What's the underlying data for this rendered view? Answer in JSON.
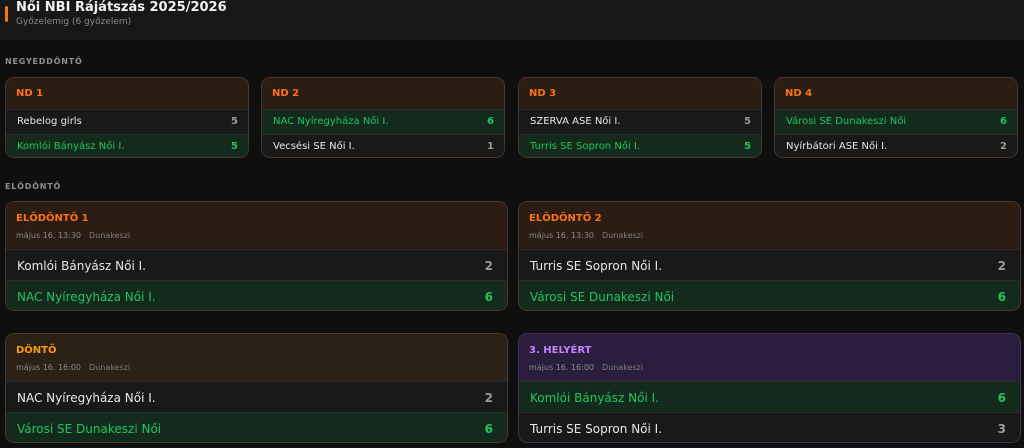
{
  "header": {
    "title": "Női NBI Rájátszás 2025/2026",
    "subtitle": "Győzelemig (6 győzelem)"
  },
  "sections": {
    "quarterfinals": "NEGYEDDÖNTŐ",
    "semifinals": "ELŐDÖNTŐ"
  },
  "quarterfinals": [
    {
      "label": "ND 1",
      "teams": [
        {
          "name": "Rebelog girls",
          "score": "5",
          "winner": false
        },
        {
          "name": "Komlói Bányász Női I.",
          "score": "5",
          "winner": true
        }
      ]
    },
    {
      "label": "ND 2",
      "teams": [
        {
          "name": "NAC Nyíregyháza Női I.",
          "score": "6",
          "winner": true
        },
        {
          "name": "Vecsési SE Női I.",
          "score": "1",
          "winner": false
        }
      ]
    },
    {
      "label": "ND 3",
      "teams": [
        {
          "name": "SZERVA ASE Női I.",
          "score": "5",
          "winner": false
        },
        {
          "name": "Turris SE Sopron Női I.",
          "score": "5",
          "winner": true
        }
      ]
    },
    {
      "label": "ND 4",
      "teams": [
        {
          "name": "Városi SE Dunakeszi Női",
          "score": "6",
          "winner": true
        },
        {
          "name": "Nyírbátori ASE Női I.",
          "score": "2",
          "winner": false
        }
      ]
    }
  ],
  "semifinals": [
    {
      "label": "ELŐDÖNTŐ 1",
      "date": "május 16. 13:30",
      "venue": "Dunakeszi",
      "teams": [
        {
          "name": "Komlói Bányász Női I.",
          "score": "2",
          "winner": false
        },
        {
          "name": "NAC Nyíregyháza Női I.",
          "score": "6",
          "winner": true
        }
      ]
    },
    {
      "label": "ELŐDÖNTŐ 2",
      "date": "május 16. 13:30",
      "venue": "Dunakeszi",
      "teams": [
        {
          "name": "Turris SE Sopron Női I.",
          "score": "2",
          "winner": false
        },
        {
          "name": "Városi SE Dunakeszi Női",
          "score": "6",
          "winner": true
        }
      ]
    }
  ],
  "final": {
    "label": "DÖNTŐ",
    "date": "május 16. 16:00",
    "venue": "Dunakeszi",
    "teams": [
      {
        "name": "NAC Nyíregyháza Női I.",
        "score": "2",
        "winner": false
      },
      {
        "name": "Városi SE Dunakeszi Női",
        "score": "6",
        "winner": true
      }
    ]
  },
  "third_place": {
    "label": "3. HELYÉRT",
    "date": "május 16. 16:00",
    "venue": "Dunakeszi",
    "teams": [
      {
        "name": "Komlói Bányász Női I.",
        "score": "6",
        "winner": true
      },
      {
        "name": "Turris SE Sopron Női I.",
        "score": "3",
        "winner": false
      }
    ]
  },
  "colors": {
    "accent": "#f97316",
    "final_accent": "#f59e0b",
    "third_accent": "#c084fc",
    "winner": "#22c55e"
  }
}
